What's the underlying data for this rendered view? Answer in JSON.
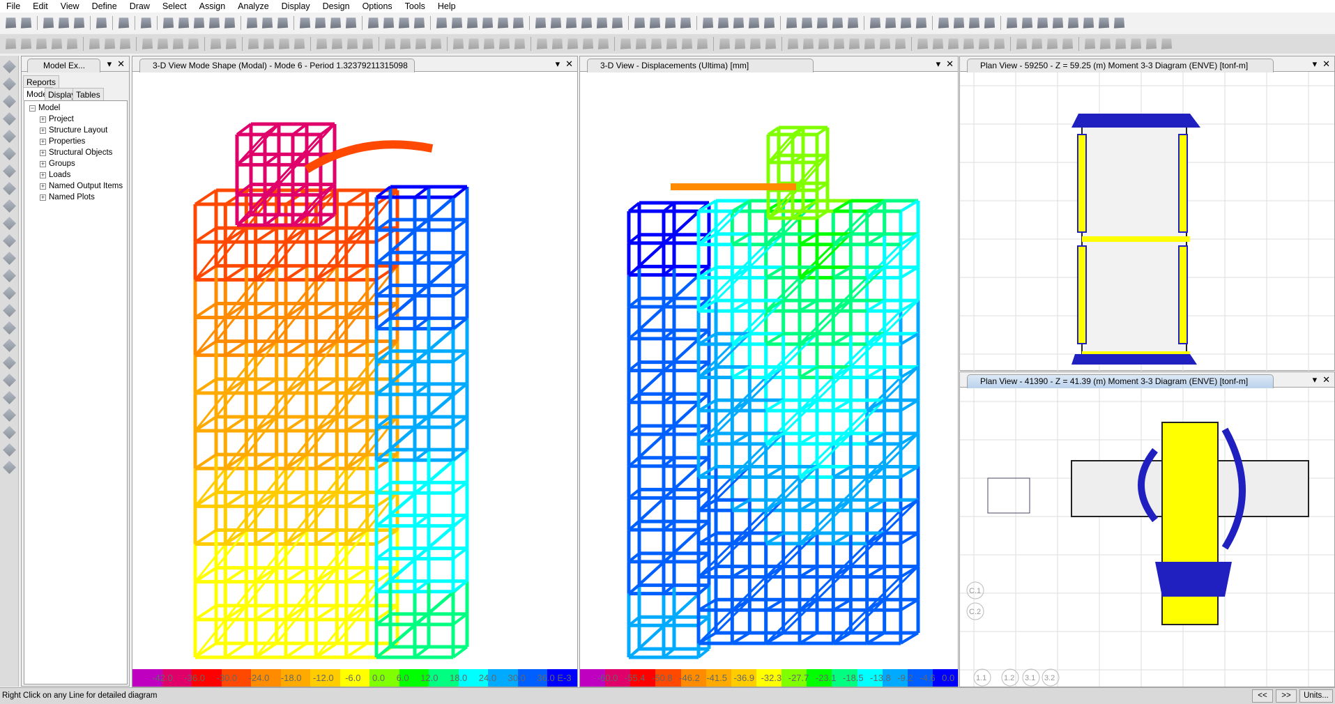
{
  "menu": [
    "File",
    "Edit",
    "View",
    "Define",
    "Draw",
    "Select",
    "Assign",
    "Analyze",
    "Display",
    "Design",
    "Options",
    "Tools",
    "Help"
  ],
  "toolbar": {
    "view_3d": "3-d",
    "plan": "pl",
    "elev": "el",
    "nd": "nd"
  },
  "explorer": {
    "title": "Model Ex...",
    "tabs": {
      "reports": "Reports",
      "model": "Model",
      "display": "Display",
      "tables": "Tables"
    },
    "tree_root": "Model",
    "tree_items": [
      "Project",
      "Structure Layout",
      "Properties",
      "Structural Objects",
      "Groups",
      "Loads",
      "Named Output Items",
      "Named Plots"
    ]
  },
  "views": [
    {
      "title": "3-D View  Mode Shape (Modal) - Mode 6 - Period 1.32379211315098",
      "legend_colors": [
        "#c000c0",
        "#e0006a",
        "#ff0000",
        "#ff4800",
        "#ff8c00",
        "#ffaa00",
        "#ffcc00",
        "#ffff00",
        "#80ff00",
        "#00ff00",
        "#00ff80",
        "#00ffff",
        "#00aaff",
        "#0060ff",
        "#0000ff"
      ],
      "legend_labels": [
        "-42.0",
        "-36.0",
        "-30.0",
        "-24.0",
        "-18.0",
        "-12.0",
        "-6.0",
        "0.0",
        "6.0",
        "12.0",
        "18.0",
        "24.0",
        "30.0",
        "36.0 E-3"
      ]
    },
    {
      "title": "3-D View  - Displacements (Ultima)  [mm]",
      "legend_colors": [
        "#c000c0",
        "#e0006a",
        "#ff0000",
        "#ff4800",
        "#ff8c00",
        "#ffaa00",
        "#ffcc00",
        "#ffff00",
        "#80ff00",
        "#00ff00",
        "#00ff80",
        "#00ffff",
        "#00aaff",
        "#0060ff",
        "#0000ff"
      ],
      "legend_labels": [
        "-60.0",
        "-55.4",
        "-50.8",
        "-46.2",
        "-41.5",
        "-36.9",
        "-32.3",
        "-27.7",
        "-23.1",
        "-18.5",
        "-13.8",
        "-9.2",
        "-4.6",
        "0.0"
      ]
    },
    {
      "title": "Plan View - 59250 - Z = 59.25 (m)    Moment 3-3 Diagram    (ENVE)  [tonf-m]"
    },
    {
      "title": "Plan View - 41390 - Z = 41.39 (m)    Moment 3-3 Diagram    (ENVE)  [tonf-m]"
    }
  ],
  "grid_labels": [
    "C.1",
    "C.2",
    "1.1",
    "1.2",
    "3.1",
    "3.2"
  ],
  "status": {
    "text": "Right Click on any Line for detailed diagram",
    "prev": "<<",
    "next": ">>",
    "units": "Units..."
  },
  "colors": {
    "moment_pos": "#ffff00",
    "moment_neg": "#2020c0",
    "frame": "#5a6070"
  }
}
